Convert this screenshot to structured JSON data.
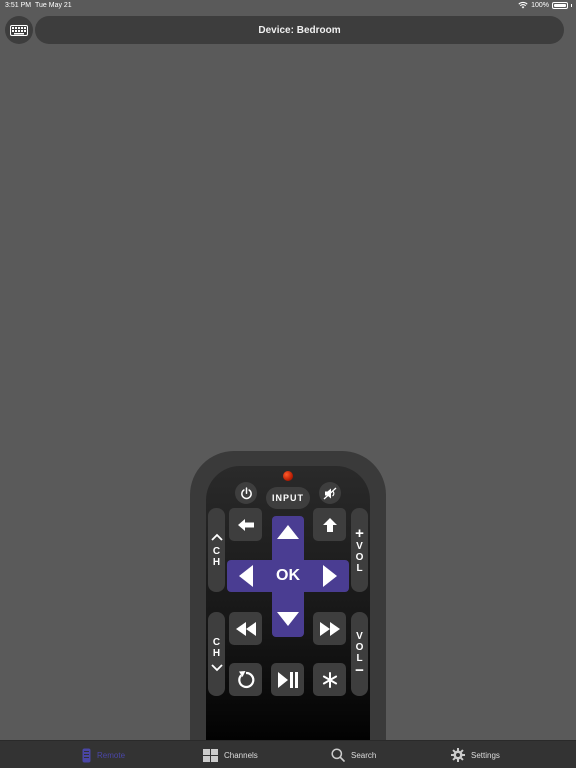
{
  "status_bar": {
    "time": "3:51 PM",
    "date": "Tue May 21",
    "battery": "100%"
  },
  "header": {
    "device_label": "Device: Bedroom",
    "keyboard_icon": "keyboard-icon"
  },
  "remote": {
    "input_label": "INPUT",
    "ok_label": "OK",
    "ch_label_top": "C\nH",
    "ch_label_bottom": "C\nH",
    "vol_label_top": "V\nO\nL",
    "vol_label_bottom": "V\nO\nL",
    "plus": "+",
    "minus": "−",
    "accent_color": "#4a3d92"
  },
  "tabs": [
    {
      "label": "Remote",
      "icon": "remote-icon",
      "active": true
    },
    {
      "label": "Channels",
      "icon": "grid-icon",
      "active": false
    },
    {
      "label": "Search",
      "icon": "search-icon",
      "active": false
    },
    {
      "label": "Settings",
      "icon": "gear-icon",
      "active": false
    }
  ]
}
